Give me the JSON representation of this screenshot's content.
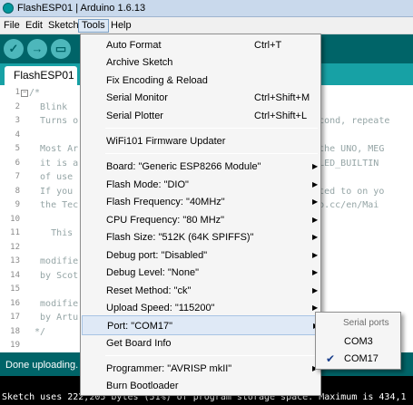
{
  "window": {
    "title": "FlashESP01 | Arduino 1.6.13"
  },
  "menubar": {
    "file": "File",
    "edit": "Edit",
    "sketch": "Sketch",
    "tools": "Tools",
    "help": "Help"
  },
  "toolbar": {
    "verify_icon": "check-icon",
    "upload_icon": "right-arrow-icon",
    "new_icon": "new-file-icon",
    "open_icon": "up-arrow-icon",
    "save_icon": "down-arrow-icon"
  },
  "tabs": [
    {
      "label": "FlashESP01"
    }
  ],
  "editor": {
    "lines": [
      {
        "n": "1",
        "text": "/*"
      },
      {
        "n": "2",
        "text": "  Blink"
      },
      {
        "n": "3",
        "text": "  Turns o                                          second, repeate"
      },
      {
        "n": "4",
        "text": ""
      },
      {
        "n": "5",
        "text": "  Most Ar                                       . On the UNO, MEG"
      },
      {
        "n": "6",
        "text": "  it is a                                       n 6. LED_BUILTIN"
      },
      {
        "n": "7",
        "text": "  of use                                        sed."
      },
      {
        "n": "8",
        "text": "  If you                                        onnected to on yo"
      },
      {
        "n": "9",
        "text": "  the Tec                                       rduino.cc/en/Mai"
      },
      {
        "n": "10",
        "text": ""
      },
      {
        "n": "11",
        "text": "    This"
      },
      {
        "n": "12",
        "text": ""
      },
      {
        "n": "13",
        "text": "  modifie"
      },
      {
        "n": "14",
        "text": "  by Scot"
      },
      {
        "n": "15",
        "text": ""
      },
      {
        "n": "16",
        "text": "  modifie"
      },
      {
        "n": "17",
        "text": "  by Artu"
      },
      {
        "n": "18",
        "text": " */"
      },
      {
        "n": "19",
        "text": ""
      }
    ]
  },
  "status": {
    "text": "Done uploading."
  },
  "console": {
    "text": "Sketch uses 222,205 bytes (51%) of program storage space. Maximum is 434,1"
  },
  "tools_menu": {
    "items": [
      {
        "label": "Auto Format",
        "shortcut": "Ctrl+T"
      },
      {
        "label": "Archive Sketch",
        "shortcut": ""
      },
      {
        "label": "Fix Encoding & Reload",
        "shortcut": ""
      },
      {
        "label": "Serial Monitor",
        "shortcut": "Ctrl+Shift+M"
      },
      {
        "label": "Serial Plotter",
        "shortcut": "Ctrl+Shift+L"
      },
      {
        "label": "WiFi101 Firmware Updater",
        "shortcut": ""
      },
      {
        "label": "Board: \"Generic ESP8266 Module\"",
        "shortcut": ""
      },
      {
        "label": "Flash Mode: \"DIO\"",
        "shortcut": ""
      },
      {
        "label": "Flash Frequency: \"40MHz\"",
        "shortcut": ""
      },
      {
        "label": "CPU Frequency: \"80 MHz\"",
        "shortcut": ""
      },
      {
        "label": "Flash Size: \"512K (64K SPIFFS)\"",
        "shortcut": ""
      },
      {
        "label": "Debug port: \"Disabled\"",
        "shortcut": ""
      },
      {
        "label": "Debug Level: \"None\"",
        "shortcut": ""
      },
      {
        "label": "Reset Method: \"ck\"",
        "shortcut": ""
      },
      {
        "label": "Upload Speed: \"115200\"",
        "shortcut": ""
      },
      {
        "label": "Port: \"COM17\"",
        "shortcut": ""
      },
      {
        "label": "Get Board Info",
        "shortcut": ""
      },
      {
        "label": "Programmer: \"AVRISP mkII\"",
        "shortcut": ""
      },
      {
        "label": "Burn Bootloader",
        "shortcut": ""
      }
    ]
  },
  "port_submenu": {
    "header": "Serial ports",
    "items": [
      {
        "label": "COM3",
        "checked": false
      },
      {
        "label": "COM17",
        "checked": true
      }
    ]
  }
}
